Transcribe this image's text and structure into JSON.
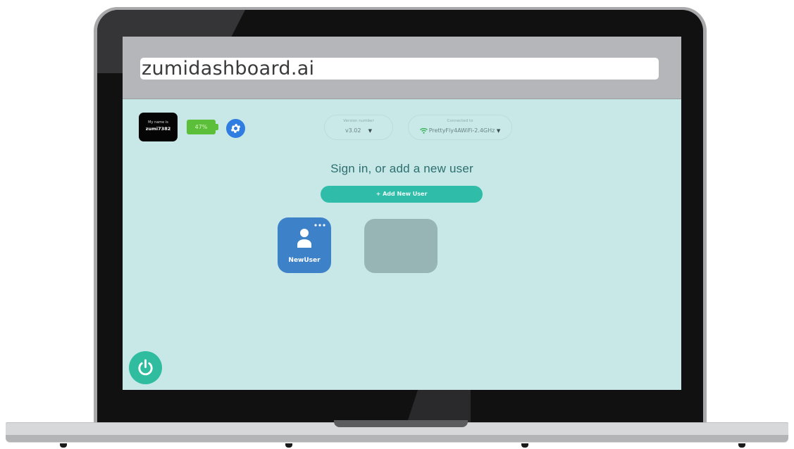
{
  "browser": {
    "address": "zumidashboard.ai"
  },
  "robot": {
    "name_caption": "My name is",
    "name": "zumi7382",
    "battery_text": "47%",
    "battery_level": 0.47
  },
  "version": {
    "label": "Version number",
    "value": "v3.02"
  },
  "connection": {
    "label": "Connected to",
    "network": "PrettyFly4AWiFi-2.4GHz"
  },
  "main": {
    "heading": "Sign in, or add a new user",
    "add_user_label": "+ Add New User"
  },
  "users": [
    {
      "name": "NewUser"
    }
  ],
  "colors": {
    "screen_bg": "#c8e8e8",
    "accent_teal": "#2fbca8",
    "user_card_blue": "#3d82c9",
    "settings_blue": "#2f7de0",
    "battery_green": "#5cbf3a"
  },
  "icons": {
    "settings": "gear-icon",
    "wifi": "wifi-icon",
    "user": "user-icon",
    "more": "more-dots-icon",
    "power": "power-icon"
  }
}
